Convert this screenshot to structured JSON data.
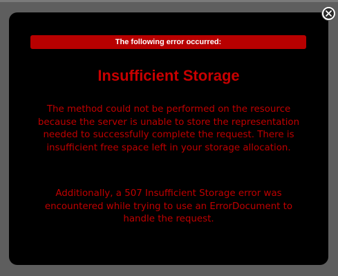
{
  "dialog": {
    "header": "The following error occurred:",
    "title": "Insufficient Storage",
    "message": "The method could not be performed on the resource because the server is unable to store the representation needed to successfully complete the request. There is insufficient free space left in your storage allocation.",
    "additional": "Additionally, a 507 Insufficient Storage error was encountered while trying to use an ErrorDocument to handle the request.",
    "close_icon": "close-icon"
  },
  "colors": {
    "backdrop": "#5e5e5e",
    "modal_bg": "#000000",
    "header_bg": "#b80000",
    "error_text": "#c80000"
  }
}
